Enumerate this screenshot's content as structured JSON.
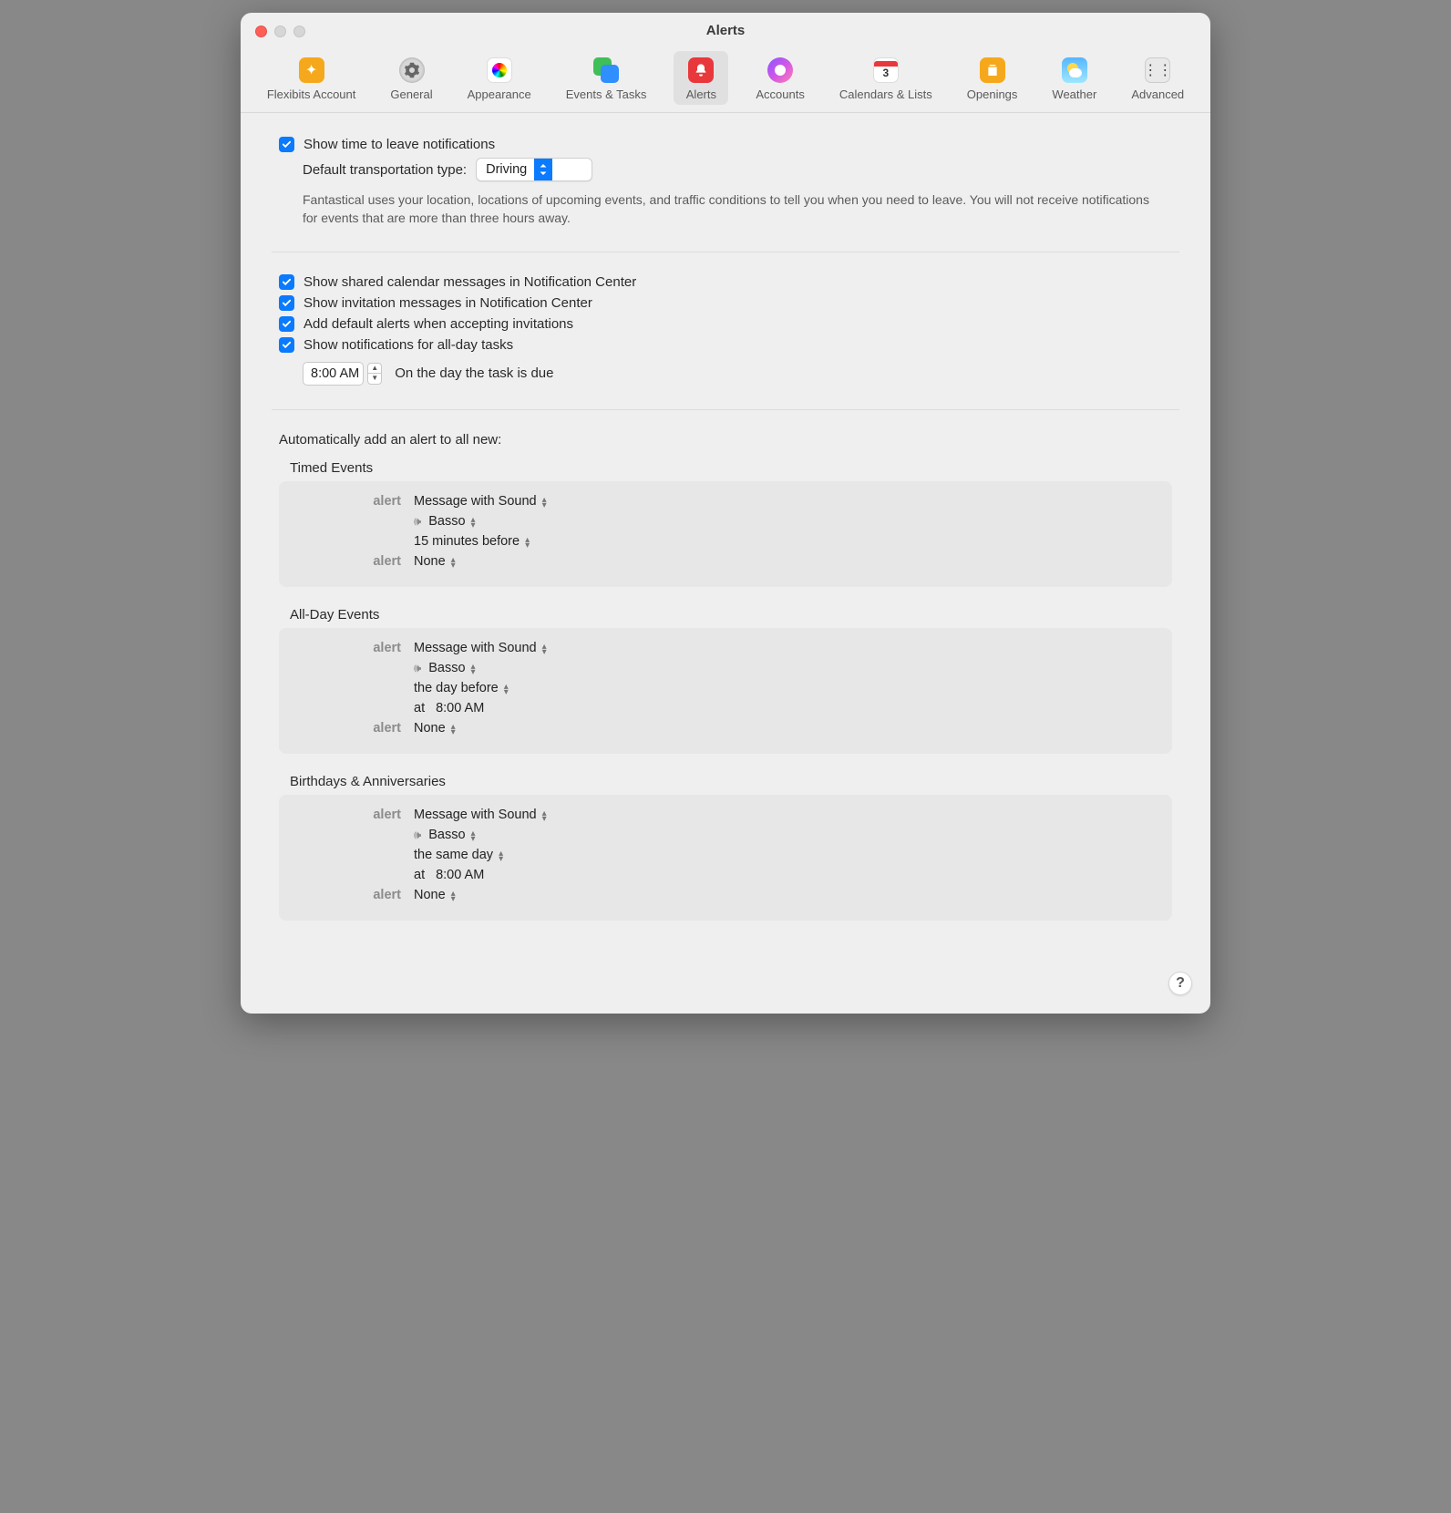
{
  "window": {
    "title": "Alerts"
  },
  "tabs": [
    {
      "label": "Flexibits Account"
    },
    {
      "label": "General"
    },
    {
      "label": "Appearance"
    },
    {
      "label": "Events & Tasks"
    },
    {
      "label": "Alerts",
      "active": true
    },
    {
      "label": "Accounts"
    },
    {
      "label": "Calendars & Lists"
    },
    {
      "label": "Openings"
    },
    {
      "label": "Weather"
    },
    {
      "label": "Advanced"
    }
  ],
  "ttl": {
    "checkbox_label": "Show time to leave notifications",
    "transport_label": "Default transportation type:",
    "transport_value": "Driving",
    "hint": "Fantastical uses your location, locations of upcoming events, and traffic conditions to tell you when you need to leave. You will not receive notifications for events that are more than three hours away."
  },
  "notif": {
    "shared": "Show shared calendar messages in Notification Center",
    "invites": "Show invitation messages in Notification Center",
    "default_alerts": "Add default alerts when accepting invitations",
    "allday_tasks": "Show notifications for all-day tasks",
    "task_time": "8:00 AM",
    "task_when": "On the day the task is due"
  },
  "auto": {
    "title": "Automatically add an alert to all new:",
    "groups": [
      {
        "title": "Timed Events",
        "rows": [
          {
            "label": "alert",
            "value": "Message with Sound"
          },
          {
            "label": "",
            "icon": "sound",
            "value": "Basso"
          },
          {
            "label": "",
            "value": "15 minutes before"
          },
          {
            "label": "alert",
            "value": "None"
          }
        ]
      },
      {
        "title": "All-Day Events",
        "rows": [
          {
            "label": "alert",
            "value": "Message with Sound"
          },
          {
            "label": "",
            "icon": "sound",
            "value": "Basso"
          },
          {
            "label": "",
            "value": "the day before"
          },
          {
            "label": "",
            "prefix": "at",
            "value": "8:00 AM",
            "plain": true
          },
          {
            "label": "alert",
            "value": "None"
          }
        ]
      },
      {
        "title": "Birthdays & Anniversaries",
        "rows": [
          {
            "label": "alert",
            "value": "Message with Sound"
          },
          {
            "label": "",
            "icon": "sound",
            "value": "Basso"
          },
          {
            "label": "",
            "value": "the same day"
          },
          {
            "label": "",
            "prefix": "at",
            "value": "8:00 AM",
            "plain": true
          },
          {
            "label": "alert",
            "value": "None"
          }
        ]
      }
    ]
  },
  "help": "?"
}
